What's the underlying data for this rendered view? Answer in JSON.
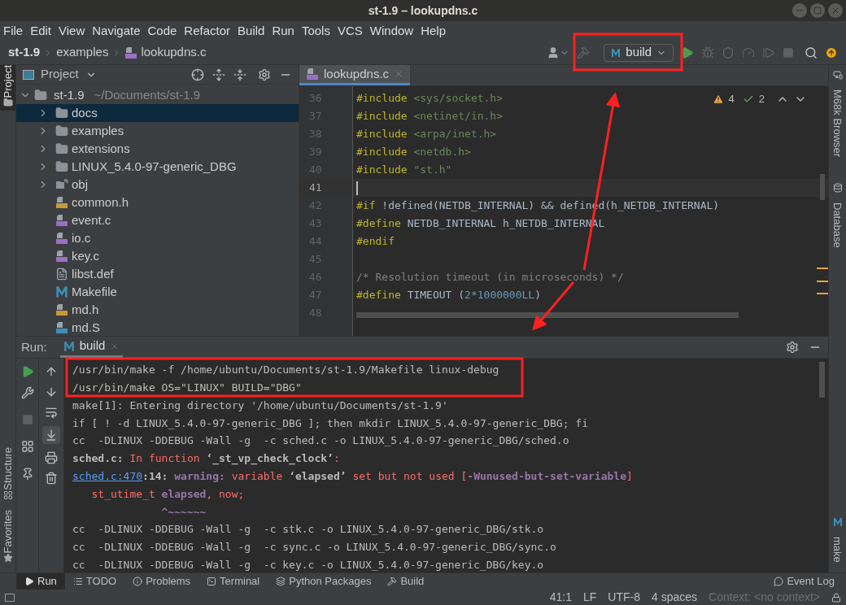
{
  "window": {
    "title": "st-1.9 – lookupdns.c"
  },
  "menu": [
    "File",
    "Edit",
    "View",
    "Navigate",
    "Code",
    "Refactor",
    "Build",
    "Run",
    "Tools",
    "VCS",
    "Window",
    "Help"
  ],
  "breadcrumb": [
    {
      "label": "st-1.9",
      "kind": "project"
    },
    {
      "label": "examples",
      "kind": "folder"
    },
    {
      "label": "lookupdns.c",
      "kind": "c-source"
    }
  ],
  "toolbar": {
    "run_configuration": "build"
  },
  "left_strip": [
    {
      "label": "Project",
      "selected": true
    },
    {
      "label": "Structure",
      "selected": false
    },
    {
      "label": "Favorites",
      "selected": false
    }
  ],
  "right_strip": [
    {
      "label": "M68k Browser"
    },
    {
      "label": "Database"
    },
    {
      "label": "make"
    }
  ],
  "project_panel": {
    "title": "Project",
    "tree": {
      "name": "st-1.9",
      "path": "~/Documents/st-1.9",
      "kind": "folder",
      "expanded": true,
      "selected": false,
      "children": [
        {
          "name": "docs",
          "kind": "folder",
          "expanded": false,
          "selected": true
        },
        {
          "name": "examples",
          "kind": "folder",
          "expanded": false,
          "selected": false
        },
        {
          "name": "extensions",
          "kind": "folder",
          "expanded": false,
          "selected": false
        },
        {
          "name": "LINUX_5.4.0-97-generic_DBG",
          "kind": "folder",
          "expanded": false,
          "selected": false
        },
        {
          "name": "obj",
          "kind": "linked-folder",
          "expanded": false,
          "selected": false
        },
        {
          "name": "common.h",
          "kind": "header",
          "selected": false
        },
        {
          "name": "event.c",
          "kind": "c-source",
          "selected": false
        },
        {
          "name": "io.c",
          "kind": "c-source",
          "selected": false
        },
        {
          "name": "key.c",
          "kind": "c-source",
          "selected": false
        },
        {
          "name": "libst.def",
          "kind": "text",
          "selected": false
        },
        {
          "name": "Makefile",
          "kind": "makefile",
          "selected": false
        },
        {
          "name": "md.h",
          "kind": "header",
          "selected": false
        },
        {
          "name": "md.S",
          "kind": "assembly",
          "selected": false
        }
      ]
    }
  },
  "editor": {
    "tabs": [
      {
        "label": "lookupdns.c",
        "selected": true
      }
    ],
    "warnings": "4",
    "typos": "2",
    "lines": [
      {
        "number": "36",
        "current": false,
        "tokens": [
          {
            "kind": "keyword",
            "text": "#include "
          },
          {
            "kind": "string",
            "text": "<sys/socket.h>"
          }
        ]
      },
      {
        "number": "37",
        "current": false,
        "tokens": [
          {
            "kind": "keyword",
            "text": "#include "
          },
          {
            "kind": "string",
            "text": "<netinet/in.h>"
          }
        ]
      },
      {
        "number": "38",
        "current": false,
        "tokens": [
          {
            "kind": "keyword",
            "text": "#include "
          },
          {
            "kind": "string",
            "text": "<arpa/inet.h>"
          }
        ]
      },
      {
        "number": "39",
        "current": false,
        "tokens": [
          {
            "kind": "keyword",
            "text": "#include "
          },
          {
            "kind": "string",
            "text": "<netdb.h>"
          }
        ]
      },
      {
        "number": "40",
        "current": false,
        "tokens": [
          {
            "kind": "keyword",
            "text": "#include "
          },
          {
            "kind": "string",
            "text": "\"st.h\""
          }
        ]
      },
      {
        "number": "41",
        "current": true
      },
      {
        "number": "42",
        "current": false,
        "tokens": [
          {
            "kind": "keyword",
            "text": "#if "
          },
          {
            "kind": "plain",
            "text": "!defined(NETDB_INTERNAL) && defined(h_NETDB_INTERNAL)"
          }
        ]
      },
      {
        "number": "43",
        "current": false,
        "tokens": [
          {
            "kind": "keyword",
            "text": "#define "
          },
          {
            "kind": "plain",
            "text": "NETDB_INTERNAL h_NETDB_INTERNAL"
          }
        ]
      },
      {
        "number": "44",
        "current": false,
        "tokens": [
          {
            "kind": "keyword",
            "text": "#endif"
          }
        ]
      },
      {
        "number": "45",
        "current": false
      },
      {
        "number": "46",
        "current": false,
        "tokens": [
          {
            "kind": "comment",
            "text": "/* Resolution timeout (in microseconds) */"
          }
        ]
      },
      {
        "number": "47",
        "current": false,
        "tokens": [
          {
            "kind": "keyword",
            "text": "#define "
          },
          {
            "kind": "plain",
            "text": "TIMEOUT ("
          },
          {
            "kind": "number",
            "text": "2*1000000LL"
          },
          {
            "kind": "plain",
            "text": ")"
          }
        ]
      },
      {
        "number": "48",
        "current": false
      }
    ]
  },
  "run_panel": {
    "label": "Run:",
    "tabs": [
      {
        "label": "build",
        "selected": true
      }
    ],
    "output": [
      [
        {
          "kind": "plain",
          "text": "/usr/bin/make -f /home/ubuntu/Documents/st-1.9/Makefile linux-debug"
        }
      ],
      [
        {
          "kind": "plain",
          "text": "/usr/bin/make OS=\"LINUX\" BUILD=\"DBG\""
        }
      ],
      [
        {
          "kind": "plain",
          "text": "make[1]: Entering directory '/home/ubuntu/Documents/st-1.9'"
        }
      ],
      [
        {
          "kind": "plain",
          "text": "if [ ! -d LINUX_5.4.0-97-generic_DBG ]; then mkdir LINUX_5.4.0-97-generic_DBG; fi"
        }
      ],
      [
        {
          "kind": "plain",
          "text": "cc  -DLINUX -DDEBUG -Wall -g  -c sched.c -o LINUX_5.4.0-97-generic_DBG/sched.o"
        }
      ],
      [
        {
          "kind": "bold",
          "text": "sched.c: "
        },
        {
          "kind": "error",
          "text": "In function "
        },
        {
          "kind": "bold",
          "text": "‘_st_vp_check_clock’"
        },
        {
          "kind": "error",
          "text": ":"
        }
      ],
      [
        {
          "kind": "link",
          "text": "sched.c:470"
        },
        {
          "kind": "bold",
          "text": ":14: "
        },
        {
          "kind": "highlight",
          "text": "warning: "
        },
        {
          "kind": "error",
          "text": "variable "
        },
        {
          "kind": "bold",
          "text": "‘elapsed’"
        },
        {
          "kind": "error",
          "text": " set but not used ["
        },
        {
          "kind": "highlight",
          "text": "-Wunused-but-set-variable"
        },
        {
          "kind": "error",
          "text": "]"
        }
      ],
      [
        {
          "kind": "error",
          "text": "   st_utime_t "
        },
        {
          "kind": "highlight",
          "text": "elapsed"
        },
        {
          "kind": "error",
          "text": ", now;"
        }
      ],
      [
        {
          "kind": "highlight",
          "text": "              ^~~~~~~"
        }
      ],
      [
        {
          "kind": "plain",
          "text": "cc  -DLINUX -DDEBUG -Wall -g  -c stk.c -o LINUX_5.4.0-97-generic_DBG/stk.o"
        }
      ],
      [
        {
          "kind": "plain",
          "text": "cc  -DLINUX -DDEBUG -Wall -g  -c sync.c -o LINUX_5.4.0-97-generic_DBG/sync.o"
        }
      ],
      [
        {
          "kind": "plain",
          "text": "cc  -DLINUX -DDEBUG -Wall -g  -c key.c -o LINUX_5.4.0-97-generic_DBG/key.o"
        }
      ]
    ]
  },
  "tool_tabs": [
    {
      "label": "Run",
      "kind": "run",
      "selected": true
    },
    {
      "label": "TODO",
      "kind": "todo",
      "selected": false
    },
    {
      "label": "Problems",
      "kind": "problems",
      "selected": false
    },
    {
      "label": "Terminal",
      "kind": "terminal",
      "selected": false
    },
    {
      "label": "Python Packages",
      "kind": "packages",
      "selected": false
    },
    {
      "label": "Build",
      "kind": "build",
      "selected": false
    }
  ],
  "event_log": "Event Log",
  "status_bar": {
    "position": "41:1",
    "line_separator": "LF",
    "encoding": "UTF-8",
    "indent": "4 spaces",
    "context": "Context: <no context>"
  }
}
